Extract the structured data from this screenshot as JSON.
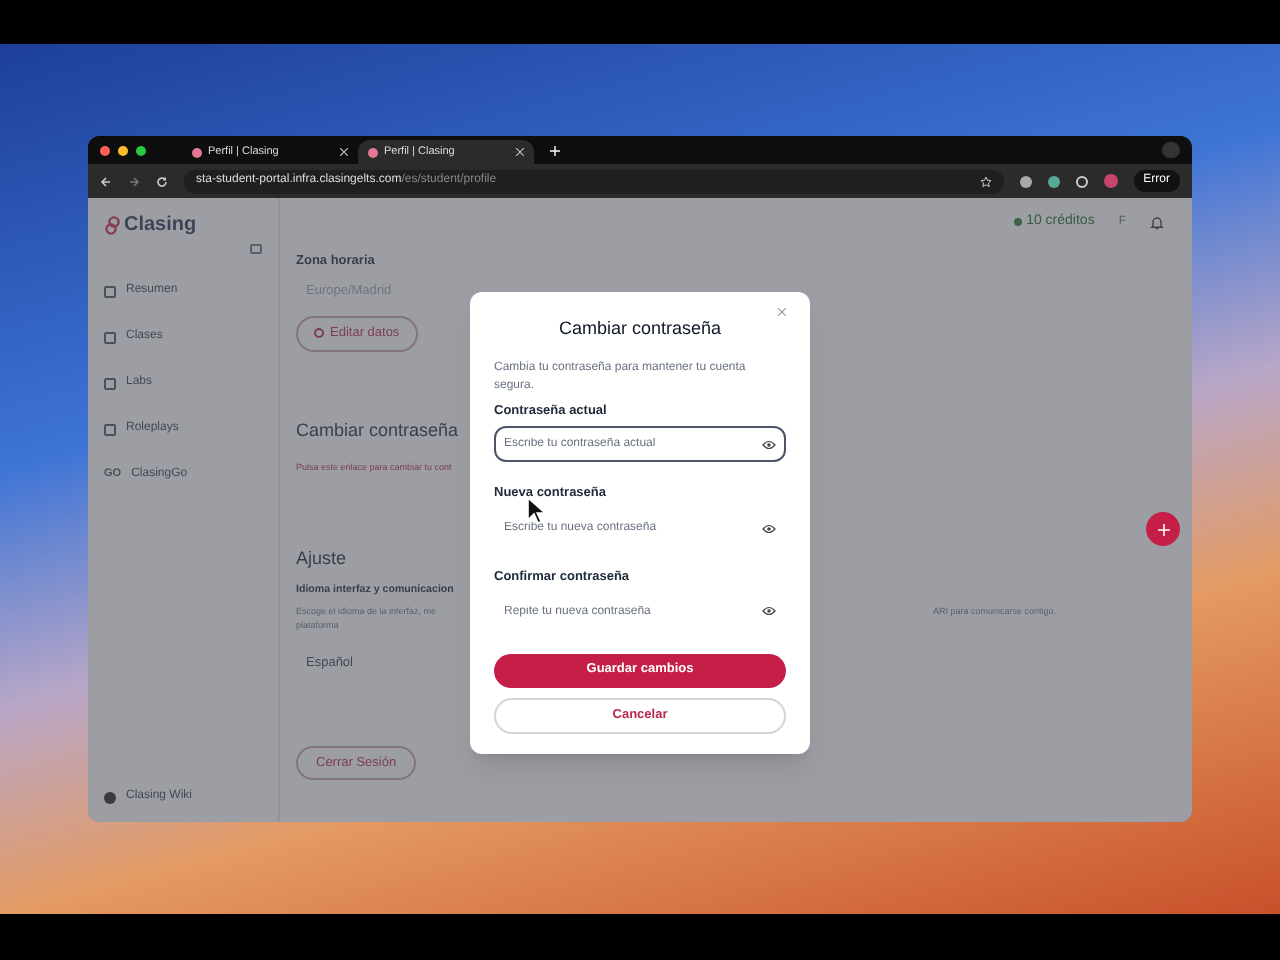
{
  "browser": {
    "tabs": [
      {
        "title": "Perfil | Clasing",
        "selected": false
      },
      {
        "title": "Perfil | Clasing",
        "selected": true
      }
    ],
    "url": {
      "host": "sta-student-portal.infra.clasingelts.com",
      "path": "/es/student/profile"
    },
    "profile_badge": "Error"
  },
  "sidebar": {
    "logo": "Clasing",
    "items": [
      {
        "label": "Resumen"
      },
      {
        "label": "Clases"
      },
      {
        "label": "Labs"
      },
      {
        "label": "Roleplays"
      },
      {
        "label": "ClasingGo",
        "icon_text": "GO"
      }
    ],
    "footer_item": "Clasing Wiki"
  },
  "header": {
    "credits": "10 créditos",
    "avatar_initial": "F"
  },
  "profile": {
    "timezone_label": "Zona horaria",
    "timezone_value": "Europe/Madrid",
    "edit_button": "Editar datos",
    "password_heading": "Cambiar contraseña",
    "password_link": "Pulsa este enlace para cambiar tu cont",
    "settings_heading": "Ajuste",
    "language_label": "Idioma interfaz y comunicacion",
    "language_description": "Escoge el idioma de la interfaz, me",
    "language_description_end": "ARI para comunicarse contigo.",
    "language_description_line2": "plataforma",
    "language_value": "Español",
    "logout_button": "Cerrar Sesión"
  },
  "modal": {
    "title": "Cambiar contraseña",
    "description": "Cambia tu contraseña para mantener tu cuenta segura.",
    "fields": [
      {
        "label": "Contraseña actual",
        "placeholder": "Escribe tu contraseña actual",
        "focused": true
      },
      {
        "label": "Nueva contraseña",
        "placeholder": "Escribe tu nueva contraseña",
        "focused": false
      },
      {
        "label": "Confirmar contraseña",
        "placeholder": "Repite tu nueva contraseña",
        "focused": false
      }
    ],
    "primary_button": "Guardar cambios",
    "secondary_button": "Cancelar"
  }
}
